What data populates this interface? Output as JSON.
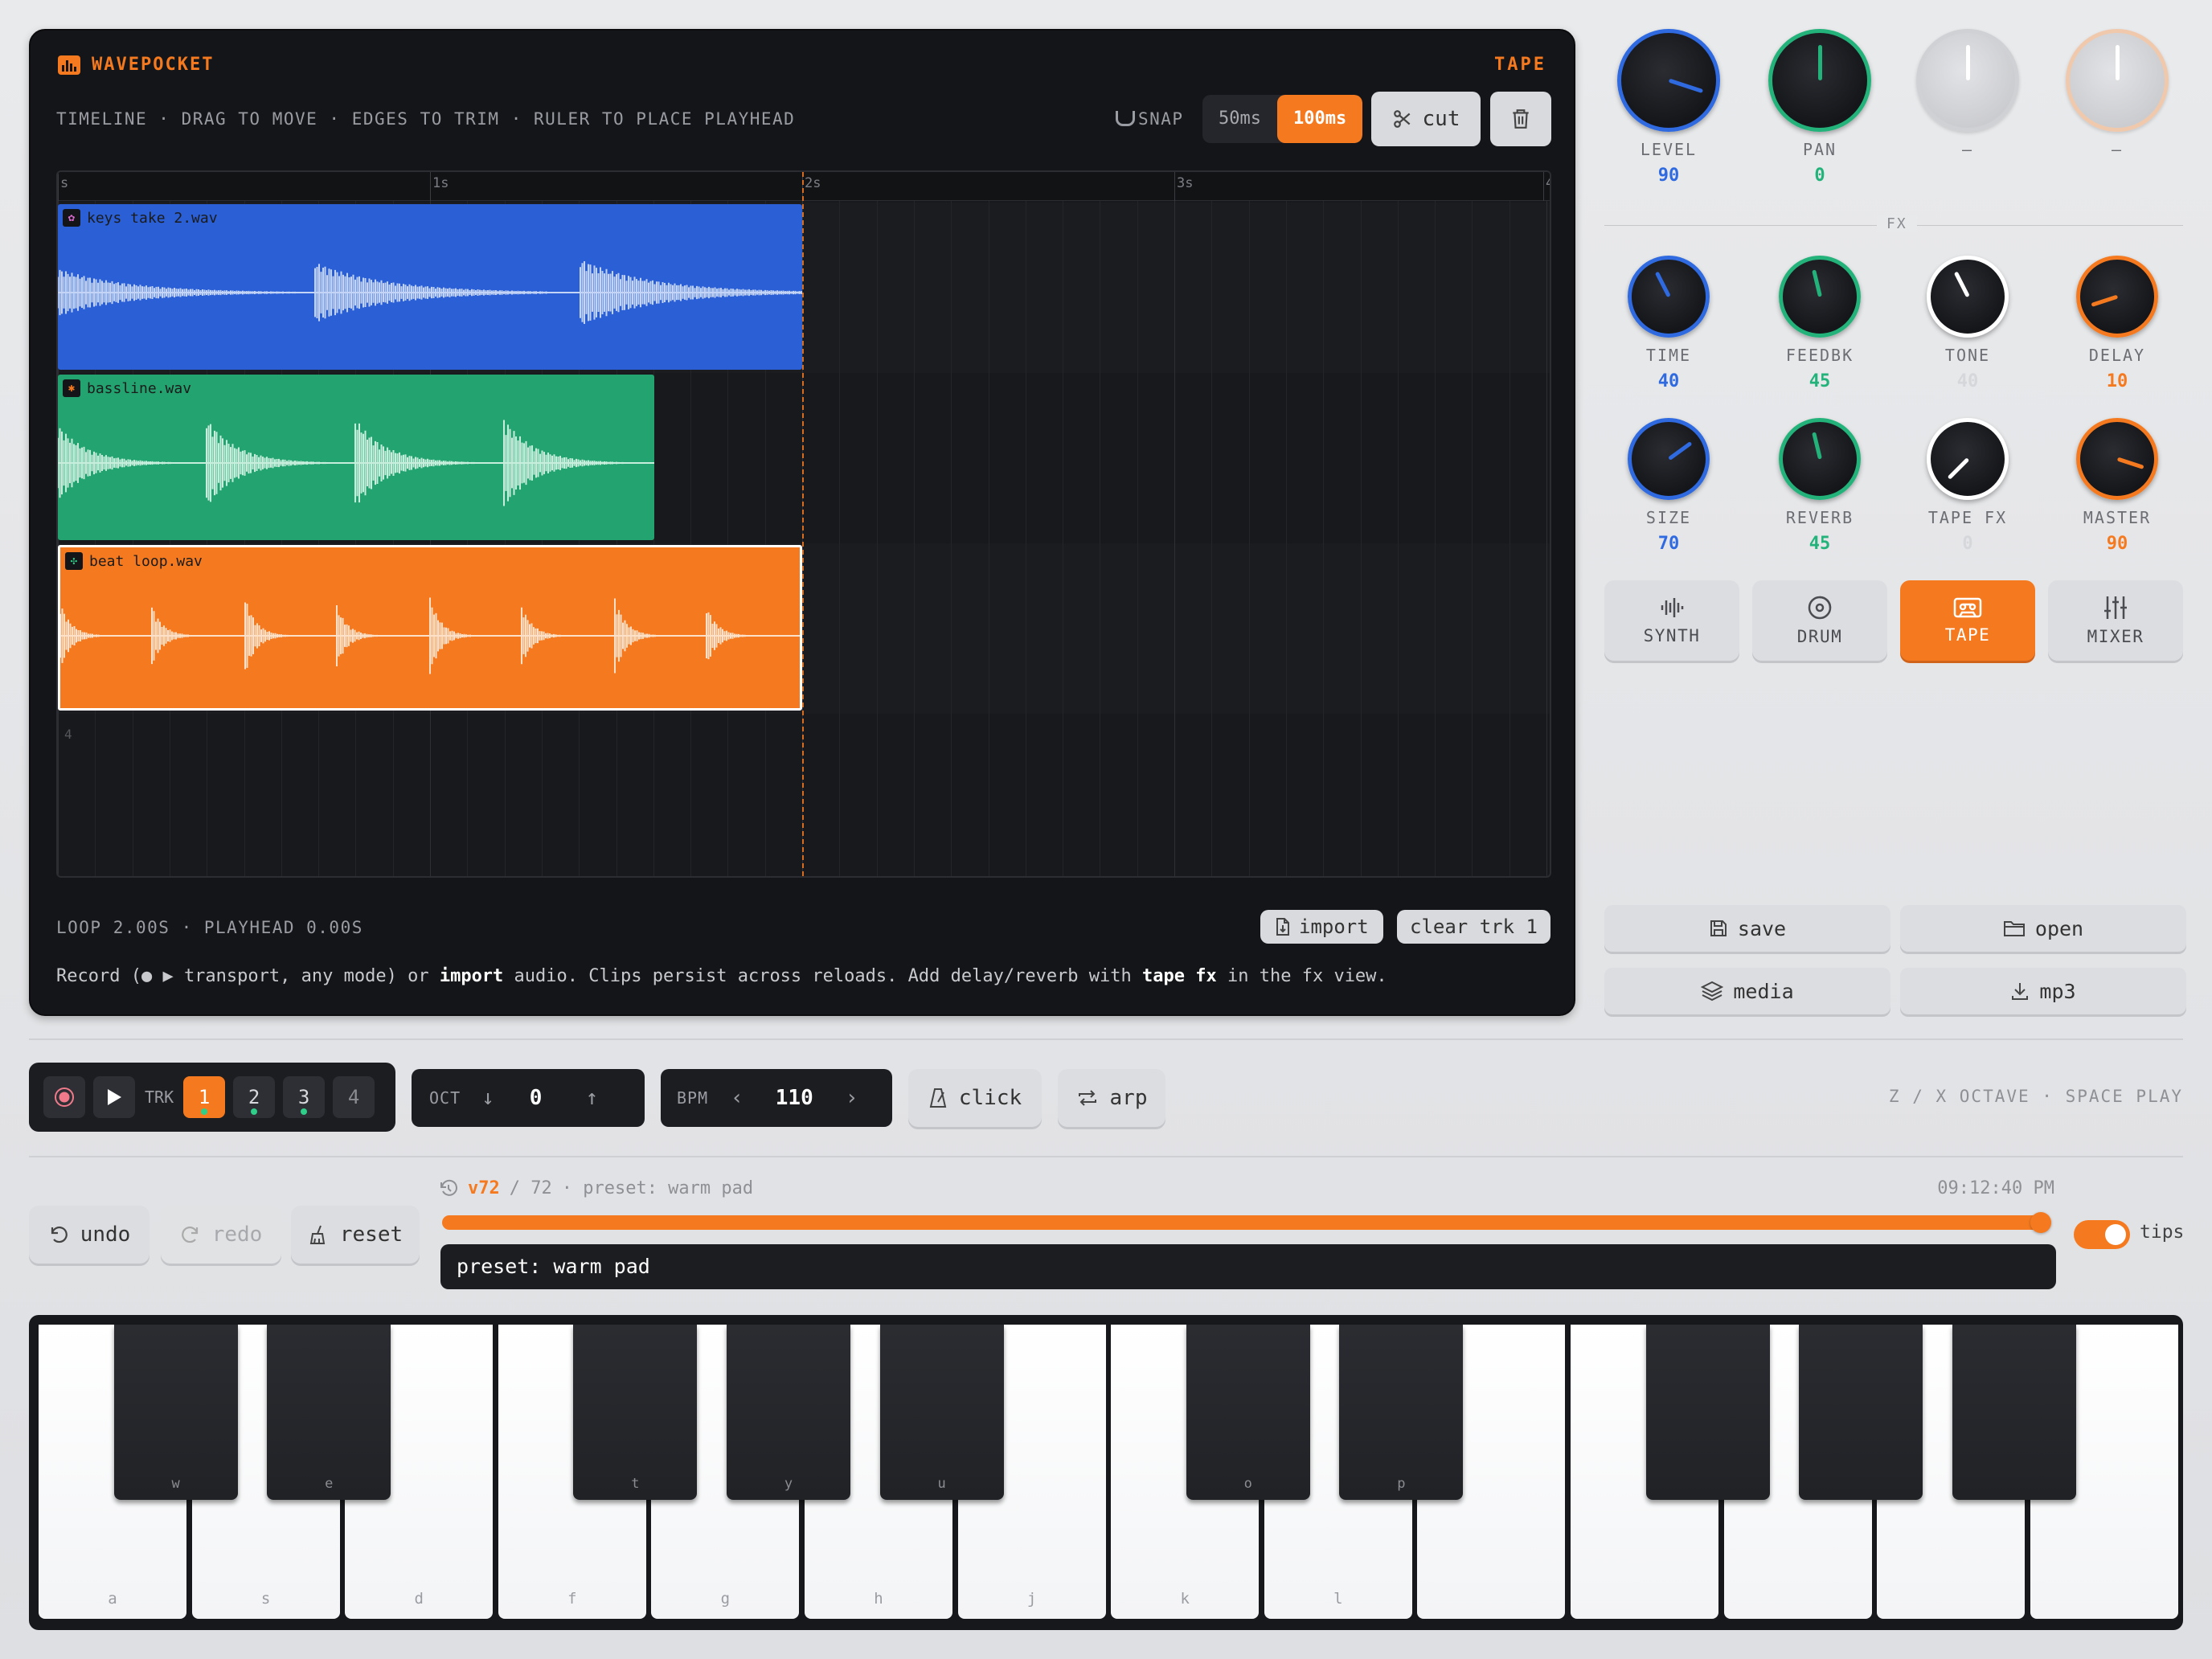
{
  "app": {
    "name": "WAVEPOCKET",
    "mode": "TAPE"
  },
  "timeline": {
    "hint": "TIMELINE · DRAG TO MOVE · EDGES TO TRIM · RULER TO PLACE PLAYHEAD",
    "snap_label": "SNAP",
    "snap_options": [
      "50ms",
      "100ms"
    ],
    "snap_selected": "100ms",
    "cut_label": "cut",
    "ruler_ticks": [
      "s",
      "1s",
      "2s",
      "3s",
      "4"
    ],
    "lane4_number": "4",
    "clips": [
      {
        "name": "keys take 2.wav",
        "color": "#2a5fd6",
        "wave": "#c4d4f6"
      },
      {
        "name": "bassline.wav",
        "color": "#23a36f",
        "wave": "#c7eedc"
      },
      {
        "name": "beat loop.wav",
        "color": "#f57a1f",
        "wave": "#fde0c8"
      }
    ],
    "status": "LOOP 2.00S · PLAYHEAD 0.00S",
    "import_label": "import",
    "clear_label": "clear trk 1"
  },
  "footer": {
    "pre": "Record (● ▶ transport, any mode) or ",
    "import": "import",
    "mid": " audio. Clips persist across reloads. Add delay/reverb with ",
    "tapefx": "tape fx",
    "post": " in the fx view."
  },
  "knobs_top": [
    {
      "name": "LEVEL",
      "value": "90",
      "color": "#2f6ae0",
      "level": 90
    },
    {
      "name": "PAN",
      "value": "0",
      "color": "#23b37a",
      "level": 50
    },
    {
      "name": "–",
      "value": "",
      "color": "#d0d1d4",
      "level": 50
    },
    {
      "name": "–",
      "value": "",
      "color": "#f0c9ad",
      "level": 50
    }
  ],
  "fx_label": "FX",
  "knobs_fx": [
    {
      "name": "TIME",
      "value": "40",
      "color": "#2f6ae0",
      "level": 40
    },
    {
      "name": "FEEDBK",
      "value": "45",
      "color": "#23b37a",
      "level": 45
    },
    {
      "name": "TONE",
      "value": "40",
      "color": "#ffffff",
      "level": 40
    },
    {
      "name": "DELAY",
      "value": "10",
      "color": "#f57a1f",
      "level": 10
    },
    {
      "name": "SIZE",
      "value": "70",
      "color": "#2f6ae0",
      "level": 70
    },
    {
      "name": "REVERB",
      "value": "45",
      "color": "#23b37a",
      "level": 45
    },
    {
      "name": "TAPE FX",
      "value": "0",
      "color": "#ffffff",
      "level": 0
    },
    {
      "name": "MASTER",
      "value": "90",
      "color": "#f57a1f",
      "level": 90
    }
  ],
  "modes": [
    {
      "label": "SYNTH",
      "icon": "waveform-icon"
    },
    {
      "label": "DRUM",
      "icon": "drum-icon"
    },
    {
      "label": "TAPE",
      "icon": "cassette-icon"
    },
    {
      "label": "MIXER",
      "icon": "sliders-icon"
    }
  ],
  "mode_selected": "TAPE",
  "file_buttons": {
    "save": "save",
    "open": "open",
    "media": "media",
    "mp3": "mp3"
  },
  "transport": {
    "trk_label": "TRK",
    "tracks": [
      "1",
      "2",
      "3",
      "4"
    ],
    "track_selected": "1",
    "oct_label": "OCT",
    "oct_value": "0",
    "bpm_label": "BPM",
    "bpm_value": "110",
    "click_label": "click",
    "arp_label": "arp",
    "key_hint": "Z / X OCTAVE · SPACE PLAY"
  },
  "history": {
    "undo": "undo",
    "redo": "redo",
    "reset": "reset",
    "version": "v72",
    "total": "/ 72",
    "desc": "· preset: warm pad",
    "time": "09:12:40 PM",
    "position": 1.0,
    "current": "preset: warm pad",
    "tips_label": "tips",
    "tips_on": true
  },
  "keyboard": {
    "white_keys": [
      "a",
      "s",
      "d",
      "f",
      "g",
      "h",
      "j",
      "k",
      "l",
      "",
      "",
      "",
      "",
      ""
    ],
    "black_keys": [
      "w",
      "e",
      "t",
      "y",
      "u",
      "o",
      "p",
      "",
      "",
      ""
    ]
  },
  "colors": {
    "accent": "#f57a1f",
    "blue": "#2f6ae0",
    "green": "#23b37a"
  }
}
